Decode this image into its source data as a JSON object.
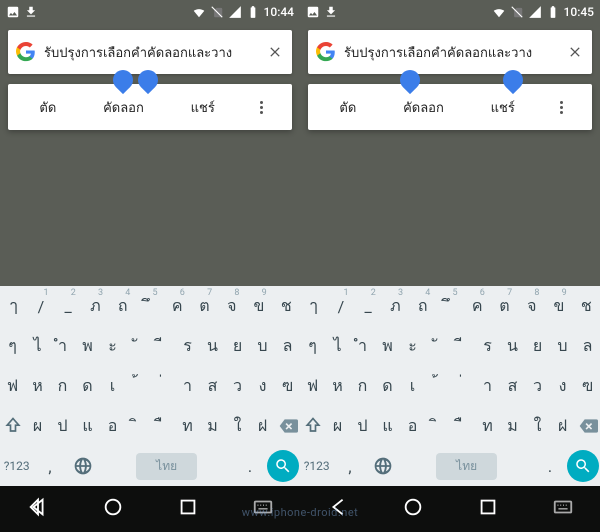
{
  "screens": [
    {
      "status": {
        "time": "10:44"
      },
      "search": {
        "text": "รับปรุงการเลือกคำคัดลอกและวาง",
        "selStart": 105,
        "selEnd": 130
      }
    },
    {
      "status": {
        "time": "10:45"
      },
      "search": {
        "text": "รับปรุงการเลือกคำคัดลอกและวาง",
        "selStart": 92,
        "selEnd": 195
      }
    }
  ],
  "popup": {
    "cut": "ตัด",
    "copy": "คัดลอก",
    "share": "แชร์"
  },
  "keyboard": {
    "rows": [
      [
        "ๅ",
        "/",
        "_",
        "ภ",
        "ถ",
        "ึ",
        "ค",
        "ต",
        "จ",
        "ข",
        "ช"
      ],
      [
        "ๆ",
        "ไ",
        "ำ",
        "พ",
        "ะ",
        "ั",
        "ี",
        "ร",
        "น",
        "ย",
        "บ",
        "ล"
      ],
      [
        "ฟ",
        "ห",
        "ก",
        "ด",
        "เ",
        "้",
        "่",
        "า",
        "ส",
        "ว",
        "ง",
        "ฃ"
      ],
      [
        "ผ",
        "ป",
        "แ",
        "อ",
        "ิ",
        "ื",
        "ท",
        "ม",
        "ใ",
        "ฝ"
      ]
    ],
    "sups": [
      "1",
      "2",
      "3",
      "4",
      "5",
      "6",
      "7",
      "8",
      "9"
    ],
    "fn": "?123",
    "space": "ไทย"
  },
  "watermark": "www.iphone-droid.net"
}
